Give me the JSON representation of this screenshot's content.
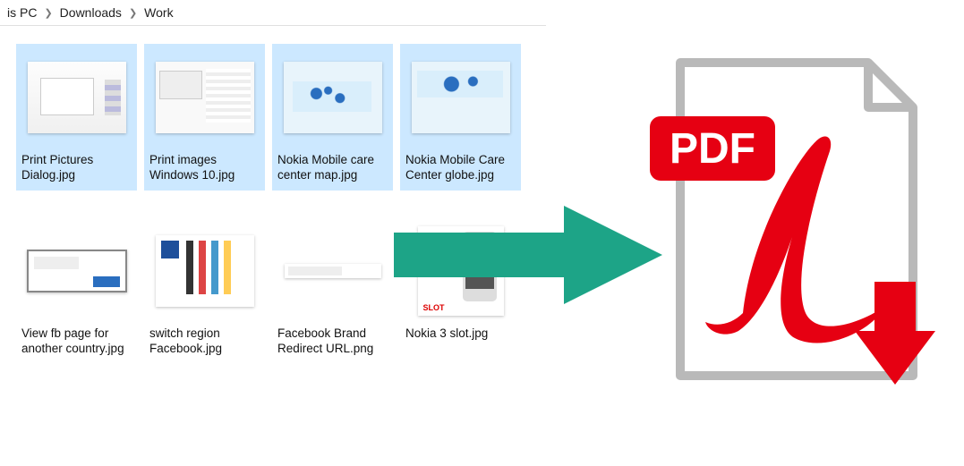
{
  "breadcrumb": {
    "parts": [
      "is PC",
      "Downloads",
      "Work"
    ]
  },
  "files": {
    "row1": [
      {
        "label": "Print Pictures Dialog.jpg",
        "selected": true
      },
      {
        "label": "Print images Windows 10.jpg",
        "selected": true
      },
      {
        "label": "Nokia Mobile care center map.jpg",
        "selected": true
      },
      {
        "label": "Nokia Mobile Care Center globe.jpg",
        "selected": true
      }
    ],
    "row2": [
      {
        "label": "View fb page for another country.jpg",
        "selected": false
      },
      {
        "label": "switch region Facebook.jpg",
        "selected": false
      },
      {
        "label": "Facebook Brand Redirect URL.png",
        "selected": false
      },
      {
        "label": "Nokia 3 slot.jpg",
        "selected": false
      }
    ]
  },
  "pdf_badge_text": "PDF",
  "colors": {
    "selection_bg": "#cce8ff",
    "arrow": "#1da487",
    "pdf_red": "#e60012",
    "page_outline": "#b9b9b9"
  }
}
